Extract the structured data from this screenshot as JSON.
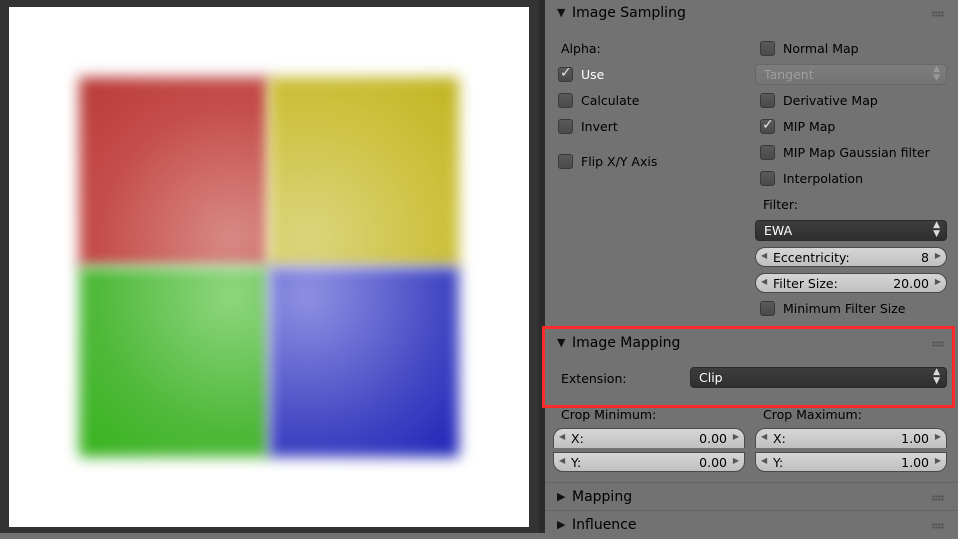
{
  "preview": {
    "quadrant_colors": {
      "top_left": "#c95250",
      "top_right": "#cfc346",
      "bottom_left": "#4fb93a",
      "bottom_right": "#4449c4"
    }
  },
  "image_sampling": {
    "title": "Image Sampling",
    "alpha_label": "Alpha:",
    "use": {
      "label": "Use",
      "checked": true
    },
    "calculate": {
      "label": "Calculate",
      "checked": false
    },
    "invert": {
      "label": "Invert",
      "checked": false
    },
    "flip_xy": {
      "label": "Flip X/Y Axis",
      "checked": false
    },
    "normal_map": {
      "label": "Normal Map",
      "checked": false
    },
    "normal_space": {
      "value": "Tangent",
      "disabled": true
    },
    "derivative_map": {
      "label": "Derivative Map",
      "checked": false
    },
    "mip_map": {
      "label": "MIP Map",
      "checked": true
    },
    "mip_gauss": {
      "label": "MIP Map Gaussian filter",
      "checked": false
    },
    "interpolation": {
      "label": "Interpolation",
      "checked": false
    },
    "filter_label": "Filter:",
    "filter_value": "EWA",
    "eccentricity": {
      "label": "Eccentricity:",
      "value": "8"
    },
    "filter_size": {
      "label": "Filter Size:",
      "value": "20.00"
    },
    "min_filter_size": {
      "label": "Minimum Filter Size",
      "checked": false
    }
  },
  "image_mapping": {
    "title": "Image Mapping",
    "extension_label": "Extension:",
    "extension_value": "Clip",
    "crop_min_label": "Crop Minimum:",
    "crop_max_label": "Crop Maximum:",
    "min_x": {
      "label": "X:",
      "value": "0.00"
    },
    "min_y": {
      "label": "Y:",
      "value": "0.00"
    },
    "max_x": {
      "label": "X:",
      "value": "1.00"
    },
    "max_y": {
      "label": "Y:",
      "value": "1.00"
    }
  },
  "mapping": {
    "title": "Mapping"
  },
  "influence": {
    "title": "Influence"
  },
  "highlight_color": "#ff2b2b"
}
